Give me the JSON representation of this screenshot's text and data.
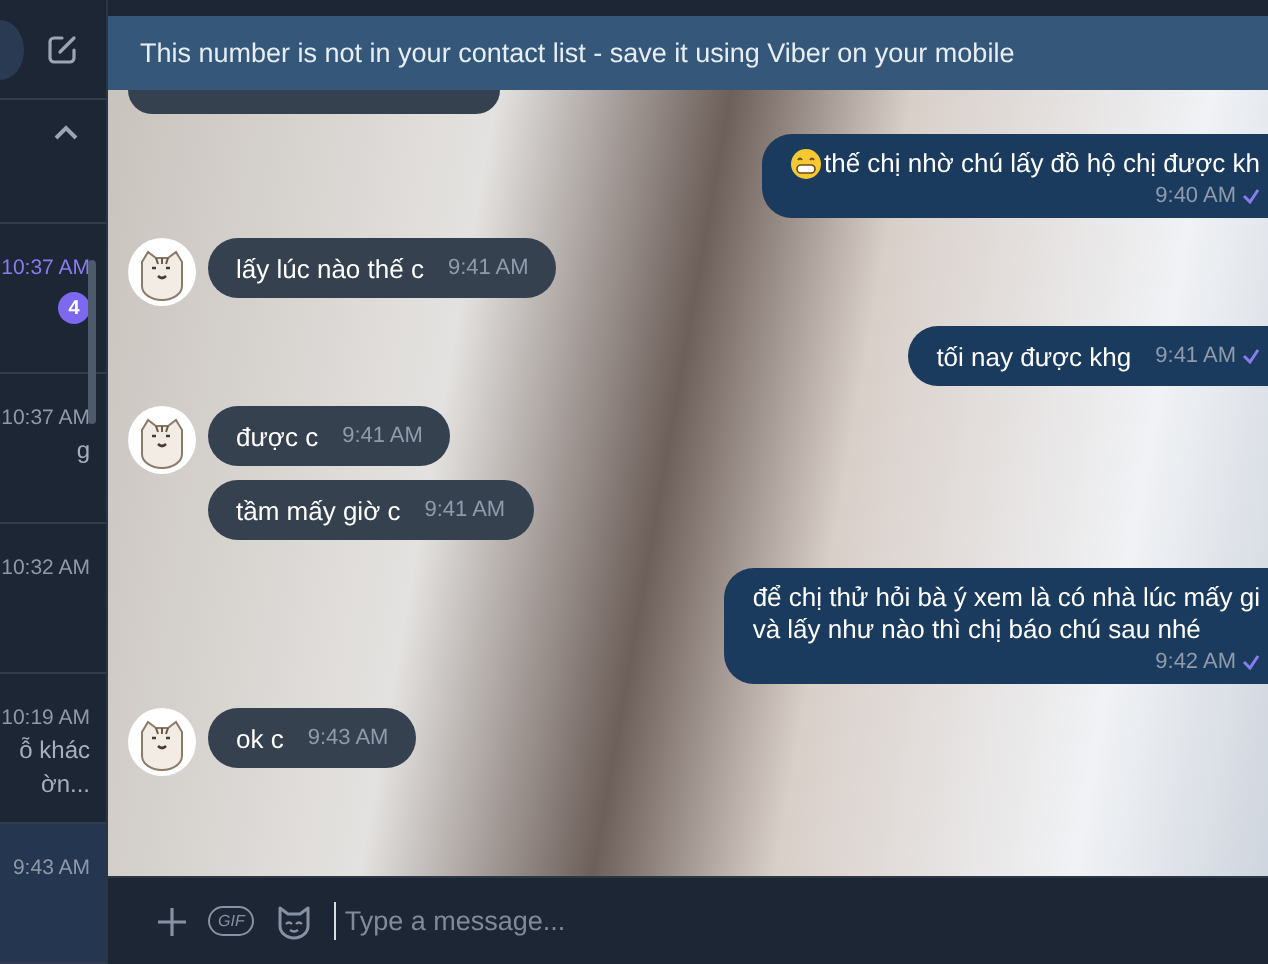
{
  "sidebar": {
    "items": [
      {
        "time": "10:37 AM",
        "unread": true,
        "badge": "4",
        "selected": false
      },
      {
        "time": "10:37 AM",
        "unread": false,
        "selected": false,
        "preview": [
          "g"
        ]
      },
      {
        "time": "10:32 AM",
        "unread": false,
        "selected": false
      },
      {
        "time": "10:19 AM",
        "unread": false,
        "selected": false,
        "preview": [
          "ỗ khác",
          "ờn..."
        ]
      },
      {
        "time": "9:43 AM",
        "unread": false,
        "selected": true
      }
    ]
  },
  "banner": "This number is not in your contact list - save it using Viber on your mobile",
  "messages": [
    {
      "kind": "hidden"
    },
    {
      "kind": "outgoing",
      "text": "thế chị nhờ chú lấy đồ hộ chị được kh",
      "time": "9:40 AM",
      "emoji": true,
      "time_below": true,
      "ticked": true
    },
    {
      "kind": "incoming",
      "text": "lấy lúc nào thế c",
      "time": "9:41 AM",
      "avatar": true
    },
    {
      "kind": "outgoing",
      "text": "tối nay được khg",
      "time": "9:41 AM",
      "emoji": false,
      "time_below": false,
      "ticked": true
    },
    {
      "kind": "incoming",
      "text": "được c",
      "time": "9:41 AM",
      "avatar": true
    },
    {
      "kind": "incoming",
      "text": "tầm mấy giờ c",
      "time": "9:41 AM",
      "avatar": false
    },
    {
      "kind": "outgoing",
      "text": "để chị thử hỏi bà ý xem là có nhà lúc mấy gi\nvà lấy như nào thì chị báo chú sau nhé",
      "time": "9:42 AM",
      "emoji": false,
      "time_below": true,
      "ticked": true
    },
    {
      "kind": "incoming",
      "text": "ok c",
      "time": "9:43 AM",
      "avatar": true
    }
  ],
  "input_bar": {
    "gif_label": "GIF",
    "placeholder": "Type a message..."
  }
}
